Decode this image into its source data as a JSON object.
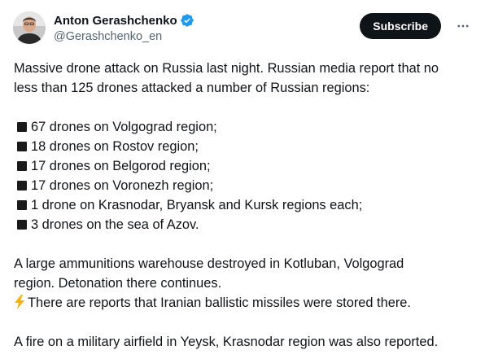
{
  "author": {
    "display_name": "Anton Gerashchenko",
    "handle": "@Gerashchenko_en"
  },
  "header": {
    "subscribe_label": "Subscribe"
  },
  "tweet": {
    "intro_lines": [
      "Massive drone attack on Russia last night. Russian media report that no",
      "less than 125 drones attacked a number of Russian regions:"
    ],
    "list_items": [
      "67 drones on Volgograd region;",
      "18 drones on Rostov region;",
      "17 drones on Belgorod region;",
      "17 drones on Voronezh region;",
      "1 drone on Krasnodar, Bryansk and Kursk regions each;",
      "3 drones on the sea of Azov."
    ],
    "warehouse_lines": [
      "A large ammunitions warehouse destroyed in Kotluban, Volgograd",
      "region. Detonation there continues."
    ],
    "missiles_line": "There are reports that Iranian ballistic missiles were stored there.",
    "airfield_line": "A fire on a military airfield in Yeysk, Krasnodar region was also reported."
  },
  "colors": {
    "text": "#0f1419",
    "secondary_text": "#536471",
    "verified_badge": "#1d9bf0",
    "subscribe_bg": "#0f1419",
    "bolt": "#f4b400"
  },
  "icons": {
    "verified": "verified-badge-icon",
    "more": "more-options-icon",
    "bullet": "black-square-icon",
    "bolt": "lightning-bolt-icon"
  }
}
